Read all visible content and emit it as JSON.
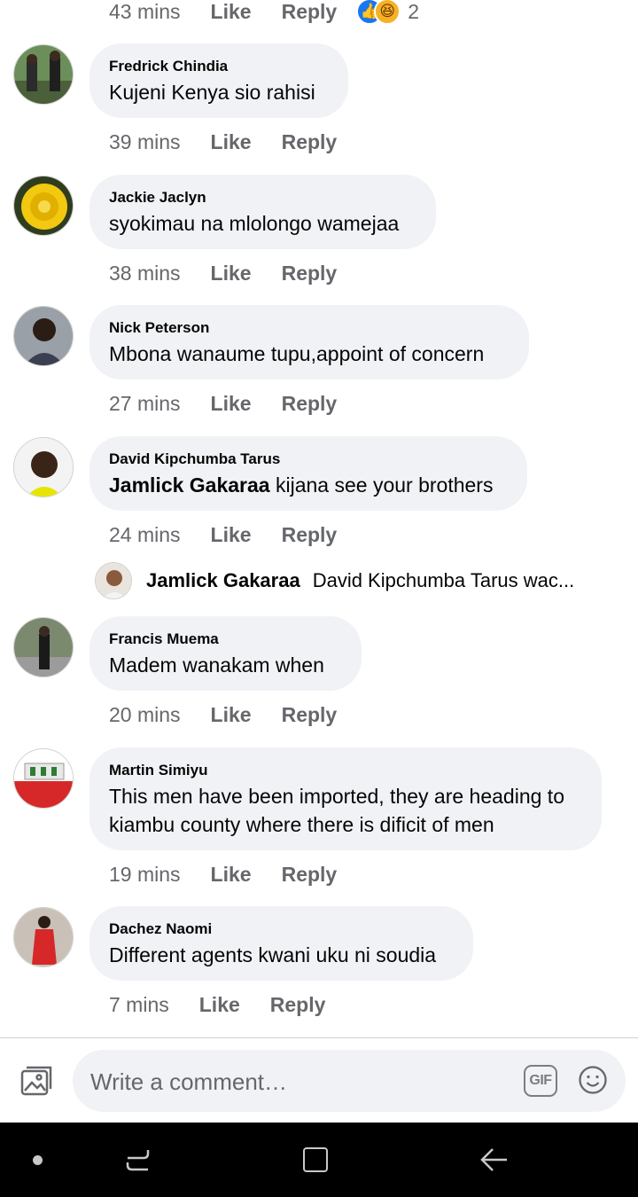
{
  "top_meta": {
    "time": "43 mins",
    "like_label": "Like",
    "reply_label": "Reply",
    "reaction_count": "2",
    "reactions": [
      "like",
      "haha"
    ]
  },
  "comments": [
    {
      "author": "Fredrick Chindia",
      "text": "Kujeni Kenya sio rahisi",
      "time": "39 mins",
      "like_label": "Like",
      "reply_label": "Reply"
    },
    {
      "author": "Jackie Jaclyn",
      "text": "syokimau na mlolongo wamejaa",
      "time": "38 mins",
      "like_label": "Like",
      "reply_label": "Reply"
    },
    {
      "author": "Nick Peterson",
      "text": "Mbona wanaume tupu,appoint of concern",
      "time": "27 mins",
      "like_label": "Like",
      "reply_label": "Reply"
    },
    {
      "author": "David Kipchumba Tarus",
      "mention": "Jamlick Gakaraa",
      "text": " kijana see your brothers",
      "time": "24 mins",
      "like_label": "Like",
      "reply_label": "Reply"
    },
    {
      "author": "Francis Muema",
      "text": "Madem wanakam when",
      "time": "20 mins",
      "like_label": "Like",
      "reply_label": "Reply"
    },
    {
      "author": "Martin Simiyu",
      "text_line1": "This men have been imported, they are heading to",
      "text_line2": "kiambu county where there is dificit of men",
      "time": "19 mins",
      "like_label": "Like",
      "reply_label": "Reply"
    },
    {
      "author": "Dachez Naomi",
      "text": "Different agents kwani uku ni soudia",
      "time": "7 mins",
      "like_label": "Like",
      "reply_label": "Reply"
    }
  ],
  "reply_preview": {
    "author": "Jamlick Gakaraa",
    "text": "David Kipchumba Tarus wac..."
  },
  "composer": {
    "placeholder": "Write a comment…",
    "gif_label": "GIF"
  },
  "colors": {
    "bubble": "#f0f2f5",
    "meta_text": "#65676b",
    "like_reaction": "#1877f2",
    "haha_reaction": "#f7b125",
    "navbar": "#000000"
  }
}
